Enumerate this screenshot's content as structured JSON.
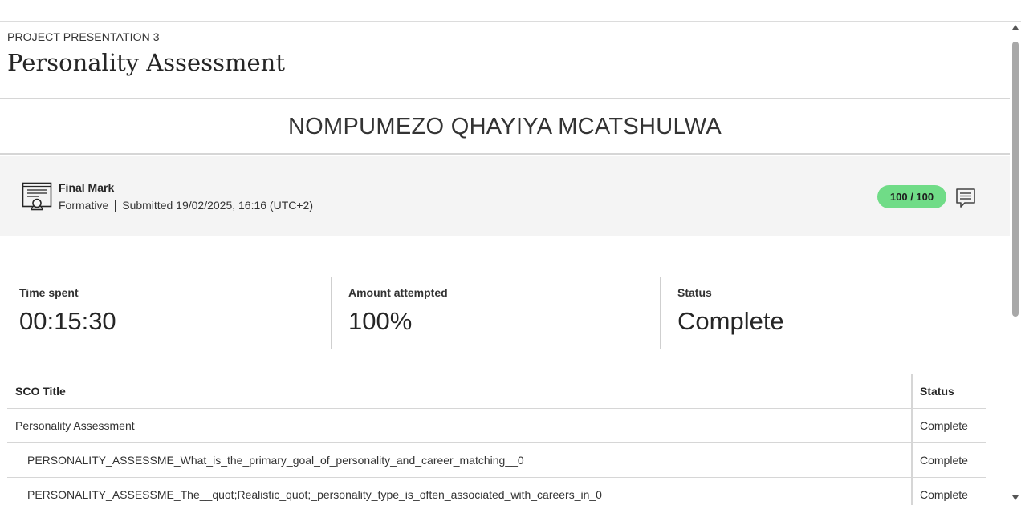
{
  "header": {
    "eyebrow": "PROJECT PRESENTATION 3",
    "title": "Personality Assessment"
  },
  "student": {
    "name": "NOMPUMEZO QHAYIYA MCATSHULWA"
  },
  "grade": {
    "title": "Final Mark",
    "type": "Formative",
    "submitted": "Submitted 19/02/2025, 16:16 (UTC+2)",
    "score": "100 / 100",
    "score_color": "#70dc87",
    "icon": "certificate-icon",
    "feedback_icon": "feedback-comment-icon"
  },
  "stats": [
    {
      "label": "Time spent",
      "value": "00:15:30"
    },
    {
      "label": "Amount attempted",
      "value": "100%"
    },
    {
      "label": "Status",
      "value": "Complete"
    }
  ],
  "table": {
    "headers": {
      "title": "SCO Title",
      "status": "Status"
    },
    "rows": [
      {
        "title": "Personality Assessment",
        "status": "Complete"
      },
      {
        "title": "PERSONALITY_ASSESSME_What_is_the_primary_goal_of_personality_and_career_matching__0",
        "status": "Complete"
      },
      {
        "title": "PERSONALITY_ASSESSME_The__quot;Realistic_quot;_personality_type_is_often_associated_with_careers_in_0",
        "status": "Complete"
      }
    ]
  }
}
